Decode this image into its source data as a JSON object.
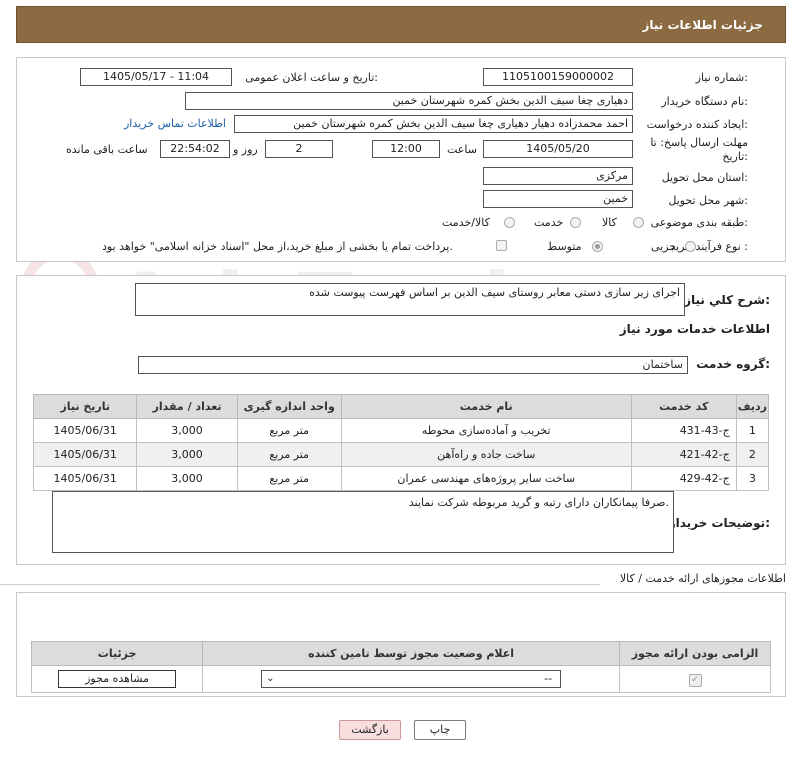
{
  "header": {
    "title": "جزئیات اطلاعات نیاز"
  },
  "form": {
    "need_number_label": "شماره نیاز:",
    "need_number": "1105100159000002",
    "announce_label": "تاریخ و ساعت اعلان عمومی:",
    "announce_value": "1405/05/17 - 11:04",
    "buyer_org_label": "نام دستگاه خریدار:",
    "buyer_org": "دهیاری چغا سیف الدین بخش کمره شهرستان خمین",
    "creator_label": "ایجاد کننده درخواست:",
    "creator": "احمد محمدزاده دهیار دهیاری چغا سیف الدین بخش کمره شهرستان خمین",
    "contact_link": "اطلاعات تماس خریدار",
    "deadline_label": "مهلت ارسال پاسخ: تا تاریخ:",
    "deadline_date": "1405/05/20",
    "time_label": "ساعت",
    "deadline_time": "12:00",
    "days_value": "2",
    "days_label": "روز و",
    "remaining_time": "22:54:02",
    "remaining_label": "ساعت باقی مانده",
    "province_label": "استان محل تحویل:",
    "province": "مرکزی",
    "city_label": "شهر محل تحویل:",
    "city": "خمین",
    "category_label": "طبقه بندی موضوعی:",
    "category_options": [
      "کالا",
      "خدمت",
      "کالا/خدمت"
    ],
    "purchase_label": "نوع فرآیند خرید :",
    "purchase_options": [
      "جزیی",
      "متوسط"
    ],
    "payment_note": "پرداخت تمام یا بخشی از مبلغ خرید،از محل \"اسناد خزانه اسلامی\" خواهد بود."
  },
  "summary": {
    "desc_label": "شرح کلي نياز:",
    "desc_value": "اجرای زیر سازی دستی معابر روستای سیف الدین بر اساس فهرست پیوست شده",
    "services_title": "اطلاعات خدمات مورد نیاز",
    "group_label": "گروه خدمت:",
    "group_value": "ساختمان"
  },
  "services_table": {
    "headers": [
      "ردیف",
      "کد خدمت",
      "نام خدمت",
      "واحد اندازه گیری",
      "تعداد / مقدار",
      "تاریخ نیاز"
    ],
    "rows": [
      [
        "1",
        "ج-43-431",
        "تخریب و آماده‌سازی محوطه",
        "متر مربع",
        "3,000",
        "1405/06/31"
      ],
      [
        "2",
        "ج-42-421",
        "ساخت جاده و راه‌آهن",
        "متر مربع",
        "3,000",
        "1405/06/31"
      ],
      [
        "3",
        "ج-42-429",
        "ساخت سایر پروژه‌های مهندسی عمران",
        "متر مربع",
        "3,000",
        "1405/06/31"
      ]
    ]
  },
  "buyer_notes": {
    "label": "توضیحات خریدار:",
    "value": "صرفا پیمانکاران دارای رتبه و گرید مربوطه شرکت نمایند."
  },
  "license": {
    "section_title": "اطلاعات مجوزهای ارائه خدمت / کالا",
    "headers": [
      "الزامی بودن ارائه مجوز",
      "اعلام وضعیت مجوز توسط تامین کننده",
      "جزئیات"
    ],
    "select_value": "--",
    "view_button": "مشاهده مجوز"
  },
  "actions": {
    "print": "چاپ",
    "back": "بازگشت"
  },
  "watermark": "AriaTender.net",
  "colors": {
    "header_bg": "#8c6a42",
    "link": "#1d5fa8",
    "back_bg": "#f8dede"
  }
}
